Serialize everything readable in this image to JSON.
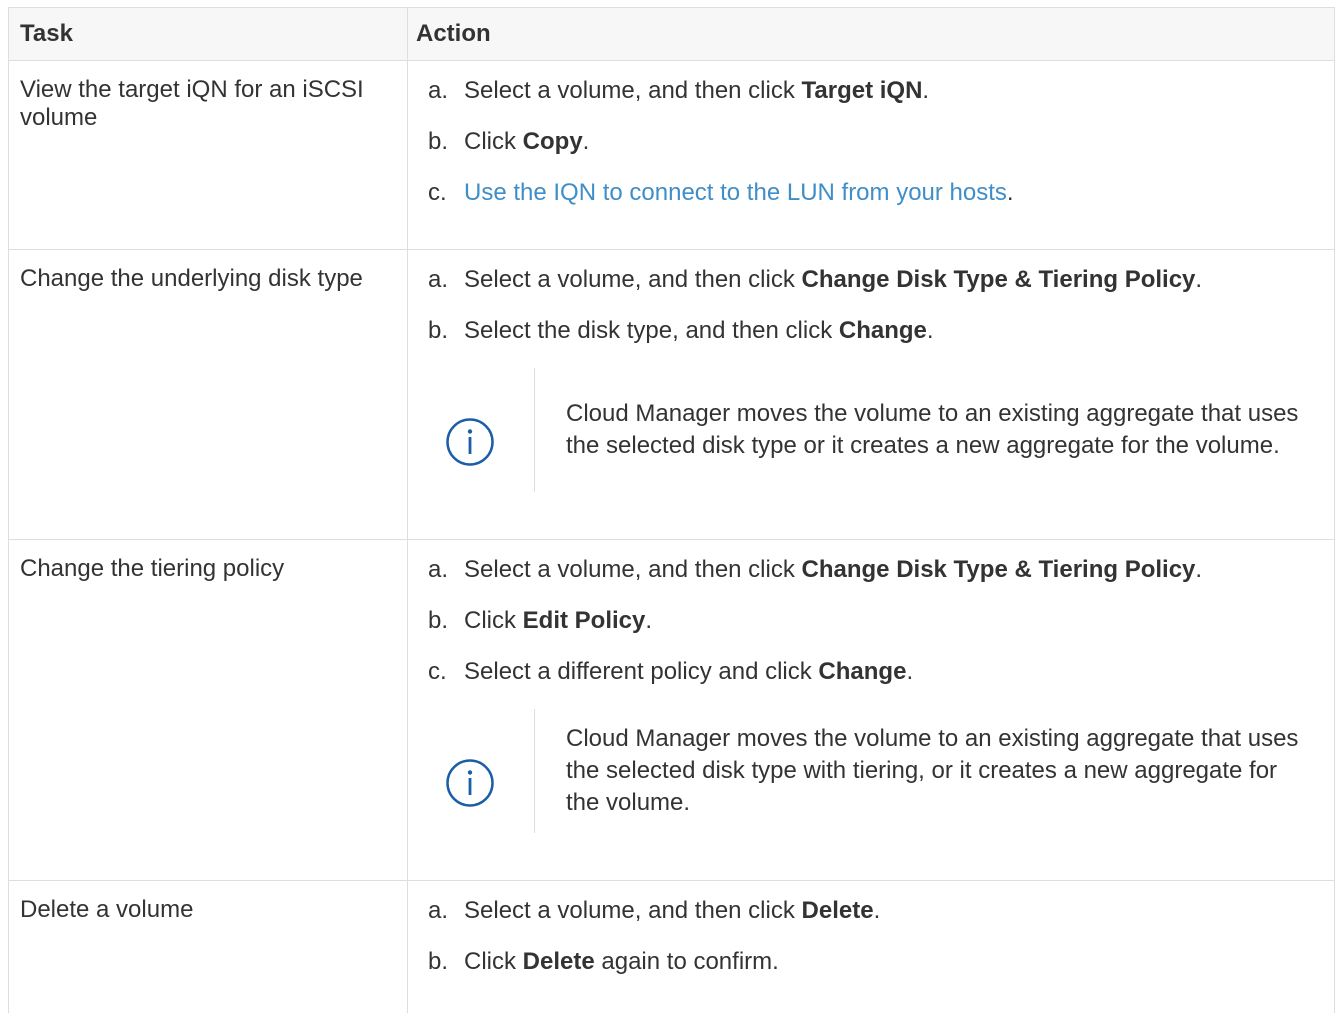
{
  "table": {
    "headers": [
      "Task",
      "Action"
    ],
    "rows": [
      {
        "task": "View the target iQN for an iSCSI volume",
        "steps": [
          {
            "marker": "a.",
            "pre": "Select a volume, and then click ",
            "bold": "Target iQN",
            "post": "."
          },
          {
            "marker": "b.",
            "pre": "Click ",
            "bold": "Copy",
            "post": "."
          },
          {
            "marker": "c.",
            "link": "Use the IQN to connect to the LUN from your hosts",
            "post": "."
          }
        ]
      },
      {
        "task": "Change the underlying disk type",
        "steps": [
          {
            "marker": "a.",
            "pre": "Select a volume, and then click ",
            "bold": "Change Disk Type & Tiering Policy",
            "post": "."
          },
          {
            "marker": "b.",
            "pre": "Select the disk type, and then click ",
            "bold": "Change",
            "post": "."
          }
        ],
        "note": "Cloud Manager moves the volume to an existing aggregate that uses the selected disk type or it creates a new aggregate for the volume."
      },
      {
        "task": "Change the tiering policy",
        "steps": [
          {
            "marker": "a.",
            "pre": "Select a volume, and then click ",
            "bold": "Change Disk Type & Tiering Policy",
            "post": "."
          },
          {
            "marker": "b.",
            "pre": "Click ",
            "bold": "Edit Policy",
            "post": "."
          },
          {
            "marker": "c.",
            "pre": "Select a different policy and click ",
            "bold": "Change",
            "post": "."
          }
        ],
        "note": "Cloud Manager moves the volume to an existing aggregate that uses the selected disk type with tiering, or it creates a new aggregate for the volume."
      },
      {
        "task": "Delete a volume",
        "steps": [
          {
            "marker": "a.",
            "pre": "Select a volume, and then click ",
            "bold": "Delete",
            "post": "."
          },
          {
            "marker": "b.",
            "pre": "Click ",
            "bold": "Delete",
            "post": " again to confirm."
          }
        ]
      }
    ]
  },
  "icons": {
    "note_icon": "info-circle-icon"
  },
  "colors": {
    "link": "#3f8ec7",
    "icon": "#1a5ea8",
    "text": "#333333",
    "header_bg": "#f7f7f8",
    "border": "#dedede"
  }
}
